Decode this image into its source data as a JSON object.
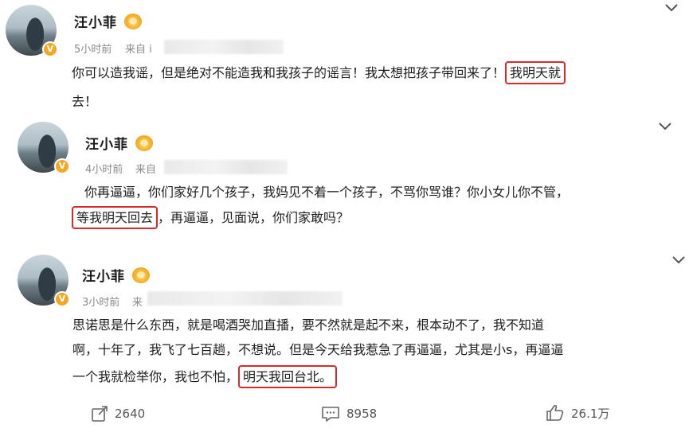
{
  "posts": [
    {
      "name": "汪小菲",
      "time": "5小时前",
      "from": "来自 i",
      "line1_pre": "你可以造我谣，但是绝对不能造我和我孩子的谣言！我太想把孩子带回来了！",
      "line1_hl": "我明天就",
      "line2": "去！"
    },
    {
      "name": "汪小菲",
      "time": "4小时前",
      "from": "来自",
      "line1": "你再逼逼，你们家好几个孩子，我妈见不着一个孩子，不骂你骂谁？你小女儿你不管，",
      "line2_hl": "等我明天回去",
      "line2_post": "，再逼逼，见面说，你们家敢吗？"
    },
    {
      "name": "汪小菲",
      "time": "3小时前",
      "from": "来",
      "line1": "思诺思是什么东西，就是喝酒哭加直播，要不然就是起不来，根本动不了，我不知道",
      "line2": "啊，十年了，我飞了七百趟，不想说。但是今天给我惹急了再逼逼，尤其是小s，再逼逼",
      "line3_pre": "一个我就检举你，我也不怕，",
      "line3_hl": "明天我回台北。"
    }
  ],
  "actions": {
    "repost": "2640",
    "comment": "8958",
    "like": "26.1万"
  },
  "icons": {
    "verified": "verified-badge-icon",
    "medal": "fan-medal-icon",
    "chevron": "chevron-down-icon",
    "repost": "repost-icon",
    "comment": "comment-icon",
    "like": "like-icon"
  },
  "colors": {
    "highlight_box": "#d8292f",
    "badge": "#f5a623"
  }
}
